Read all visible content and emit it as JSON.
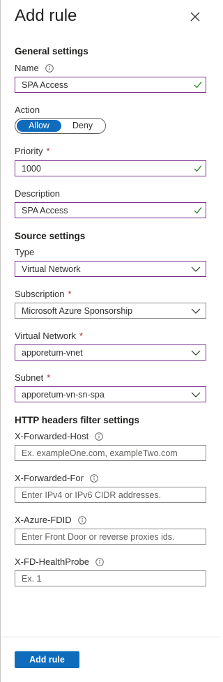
{
  "panel": {
    "title": "Add rule"
  },
  "general": {
    "heading": "General settings",
    "name": {
      "label": "Name",
      "value": "SPA Access"
    },
    "action": {
      "label": "Action",
      "options": [
        "Allow",
        "Deny"
      ],
      "selected": "Allow"
    },
    "priority": {
      "label": "Priority",
      "required": "*",
      "value": "1000"
    },
    "description": {
      "label": "Description",
      "value": "SPA Access"
    }
  },
  "source": {
    "heading": "Source settings",
    "type": {
      "label": "Type",
      "value": "Virtual Network"
    },
    "subscription": {
      "label": "Subscription",
      "required": "*",
      "value": "Microsoft Azure Sponsorship"
    },
    "vnet": {
      "label": "Virtual Network",
      "required": "*",
      "value": "apporetum-vnet"
    },
    "subnet": {
      "label": "Subnet",
      "required": "*",
      "value": "apporetum-vn-sn-spa"
    }
  },
  "http": {
    "heading": "HTTP headers filter settings",
    "forwarded_host": {
      "label": "X-Forwarded-Host",
      "placeholder": "Ex. exampleOne.com, exampleTwo.com"
    },
    "forwarded_for": {
      "label": "X-Forwarded-For",
      "placeholder": "Enter IPv4 or IPv6 CIDR addresses."
    },
    "azure_fdid": {
      "label": "X-Azure-FDID",
      "placeholder": "Enter Front Door or reverse proxies ids."
    },
    "fd_healthprobe": {
      "label": "X-FD-HealthProbe",
      "placeholder": "Ex. 1"
    }
  },
  "footer": {
    "add_button": "Add rule"
  },
  "colors": {
    "accent": "#0f6cbd",
    "field_border": "#7a2f8f",
    "valid_check": "#107c10",
    "required": "#a4262c"
  },
  "icons": {
    "close": "close-icon",
    "info": "info-icon",
    "valid": "checkmark-icon",
    "dropdown": "chevron-down-icon"
  }
}
